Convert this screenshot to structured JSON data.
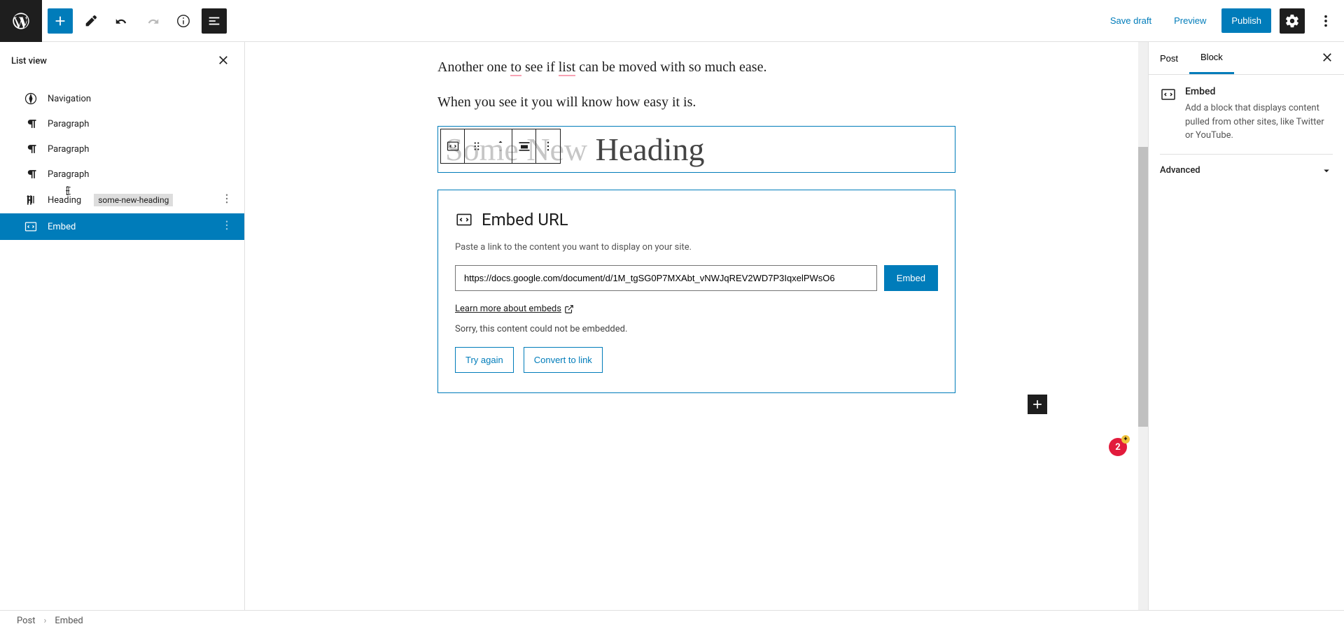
{
  "toolbar": {
    "save_draft": "Save draft",
    "preview": "Preview",
    "publish": "Publish"
  },
  "list_view": {
    "title": "List view",
    "items": [
      {
        "icon": "navigation",
        "label": "Navigation"
      },
      {
        "icon": "paragraph",
        "label": "Paragraph"
      },
      {
        "icon": "paragraph",
        "label": "Paragraph"
      },
      {
        "icon": "paragraph",
        "label": "Paragraph"
      },
      {
        "icon": "heading",
        "label": "Heading",
        "anchor": "some-new-heading"
      },
      {
        "icon": "embed",
        "label": "Embed",
        "selected": true
      }
    ]
  },
  "editor": {
    "paragraph1_pre": "Another one ",
    "paragraph1_sp1": "to",
    "paragraph1_mid": " see if ",
    "paragraph1_sp2": "list",
    "paragraph1_post": " can be moved with so much ease.",
    "paragraph2": "When you see it you will know how easy it is.",
    "heading_pre": "Some New",
    "heading_post": " Heading",
    "embed": {
      "title": "Embed URL",
      "desc": "Paste a link to the content you want to display on your site.",
      "url": "https://docs.google.com/document/d/1M_tgSG0P7MXAbt_vNWJqREV2WD7P3IqxelPWsO6",
      "submit": "Embed",
      "learn": "Learn more about embeds",
      "error": "Sorry, this content could not be embedded.",
      "try_again": "Try again",
      "convert": "Convert to link"
    }
  },
  "settings": {
    "tabs": {
      "post": "Post",
      "block": "Block"
    },
    "block_name": "Embed",
    "block_desc": "Add a block that displays content pulled from other sites, like Twitter or YouTube.",
    "advanced": "Advanced"
  },
  "breadcrumb": {
    "root": "Post",
    "current": "Embed"
  },
  "notif_count": "2"
}
